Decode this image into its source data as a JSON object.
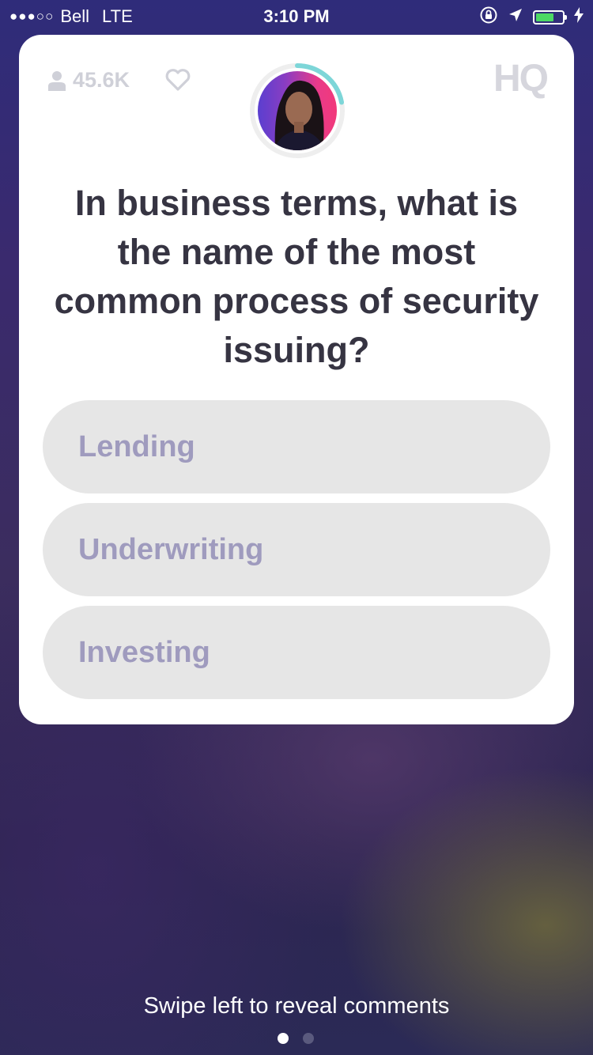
{
  "status_bar": {
    "signal": "●●●○○",
    "carrier": "Bell",
    "network": "LTE",
    "time": "3:10 PM",
    "battery_level": 0.7
  },
  "game": {
    "viewer_count": "45.6K",
    "logo": "HQ",
    "timer_remaining": 0.22,
    "question": "In business terms, what is the name of the most common process of security issuing?",
    "answers": [
      {
        "label": "Lending"
      },
      {
        "label": "Underwriting"
      },
      {
        "label": "Investing"
      }
    ]
  },
  "footer": {
    "hint": "Swipe left to reveal comments",
    "page_index": 0,
    "page_count": 2
  },
  "colors": {
    "card_bg": "#ffffff",
    "answer_bg": "#e6e6e6",
    "answer_text": "#9f9bbe",
    "question_text": "#363442",
    "timer_ring": "#7dd6d8",
    "battery": "#4cd964"
  },
  "icons": [
    "person-icon",
    "heart-icon",
    "orientation-lock-icon",
    "location-arrow-icon",
    "battery-icon",
    "charging-bolt-icon"
  ]
}
